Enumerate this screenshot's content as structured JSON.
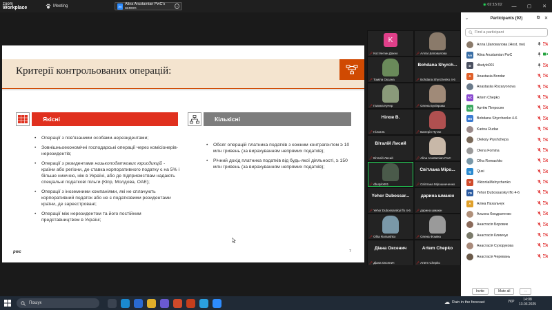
{
  "app": {
    "brand_line1": "zoom",
    "brand_line2": "Workplace",
    "meeting_label": "Meeting",
    "share_initials": "AA",
    "share_label": "Alina Arustamian PwC's screen",
    "timer": "02:15:02",
    "window_controls": [
      "—",
      "▢",
      "✕"
    ]
  },
  "slide": {
    "title": "Критерії контрольованих операцій:",
    "page_number": "7",
    "footer_mark": "pwc",
    "left": {
      "header": "Якісні",
      "header_color": "#e0301e",
      "bullets": [
        {
          "text": "Операції з пов'язаними особами-нерезидентами;"
        },
        {
          "text": "Зовнішньоекономічні господарські операції через комісіонерів-нерезидентів;"
        },
        {
          "pre": "Операції з резидентами ",
          "em": "низькоподаткових юрисдикцій",
          "post": " - країни або регіони, де ставка корпоративного податку є на 5% і більше нижчою, ніж в Україні, або де підприємствам надають спеціальні податкові пільги (Кіпр, Молдова, ОАЕ);"
        },
        {
          "text": "Операції з іноземними компаніями, які не сплачують корпоративний податок або не є податковими резидентами країни, де зареєстровані;"
        },
        {
          "text": "Операції між нерезидентом та його постійним представництвом в Україні;"
        }
      ]
    },
    "right": {
      "header": "Кількісні",
      "header_color": "#7d7d7d",
      "bullets": [
        {
          "text": "Обсяг операцій платника податків з кожним контрагентом ≥ 10 млн гривень (за вирахуванням непрямих податків);"
        },
        {
          "text": "Річний дохід платника податків від будь-якої діяльності, ≥ 150 млн гривень (за вирахуванням непрямих податків);"
        }
      ]
    }
  },
  "video_tiles": [
    {
      "name": "Костянтин Дахно",
      "kind": "avatar",
      "letter": "K",
      "color": "#e0408a"
    },
    {
      "name": "Алла Шаповалова",
      "kind": "photo",
      "color": "#8a7a6a"
    },
    {
      "name": "Томіла Оксана",
      "kind": "photo",
      "color": "#6a8a5a"
    },
    {
      "name": "Bohdana Shyrchenko 4-6",
      "kind": "name",
      "big": "Bohdana Shyrch..."
    },
    {
      "name": "Галина Кучер",
      "kind": "photo",
      "color": "#8a9a7a"
    },
    {
      "name": "Олена Буліярова",
      "kind": "photo",
      "color": "#a08a78"
    },
    {
      "name": "Нілов В.",
      "kind": "name",
      "big": "Нілов В."
    },
    {
      "name": "Валерія Путан",
      "kind": "photo",
      "color": "#b05050"
    },
    {
      "name": "Віталій Лисий",
      "kind": "name",
      "big": "Віталій Лисий"
    },
    {
      "name": "Alina Arustamian PwC",
      "kind": "photo",
      "color": "#c8b8a8"
    },
    {
      "name": "dbutylo001",
      "kind": "photo",
      "color": "#4a5a4a"
    },
    {
      "name": "Світлана Мірошниченко",
      "kind": "name",
      "big": "Світлана Міро..."
    },
    {
      "name": "Yehor Dubossarskyi ffo 4-6",
      "kind": "name",
      "big": "Yehor Dubossar..."
    },
    {
      "name": "дарина шмаюн",
      "kind": "name",
      "big": "дарина шмаюн"
    },
    {
      "name": "Olha Romashko",
      "kind": "photo",
      "color": "#7a98a8"
    },
    {
      "name": "Олена Фоміна",
      "kind": "photo",
      "color": "#9a9a9a"
    },
    {
      "name": "Діана Оксенич",
      "kind": "name",
      "big": "Діана Оксенич"
    },
    {
      "name": "Artem Chepko",
      "kind": "name",
      "big": "Artem Chepko"
    }
  ],
  "participants": {
    "title": "Participants (92)",
    "search_placeholder": "Find a participant",
    "invite_label": "Invite",
    "mute_all_label": "Mute all",
    "more_label": "···",
    "list": [
      {
        "name": "Алла Шаповалова (Host, me)",
        "initials": "",
        "color": "#8a7a6a",
        "mic": "on",
        "video": "off"
      },
      {
        "name": "Alina Arustamian PwC",
        "initials": "AA",
        "color": "#3a6ea5",
        "mic": "on",
        "video": "on"
      },
      {
        "name": "dbutylo001",
        "initials": "D",
        "color": "#4a5060",
        "mic": "on",
        "video": "off"
      },
      {
        "name": "Anastasia Bondar",
        "initials": "A",
        "color": "#e0602a",
        "mic": "off",
        "video": "off"
      },
      {
        "name": "Anastasiia Rozaryonova",
        "initials": "",
        "color": "#6a7a8a",
        "mic": "off",
        "video": "off"
      },
      {
        "name": "Artem Chepko",
        "initials": "AC",
        "color": "#8a4ad0",
        "mic": "off",
        "video": "off"
      },
      {
        "name": "Артём Петросян",
        "initials": "АП",
        "color": "#3aa860",
        "mic": "off",
        "video": "off"
      },
      {
        "name": "Bohdana Shyrchenko 4-6",
        "initials": "BS",
        "color": "#3a7ad0",
        "mic": "off",
        "video": "off"
      },
      {
        "name": "Karina Rudas",
        "initials": "",
        "color": "#9a8a8a",
        "mic": "off",
        "video": "off"
      },
      {
        "name": "Oleksiy Pryshchepa",
        "initials": "",
        "color": "#7a6a5a",
        "mic": "off",
        "video": "off"
      },
      {
        "name": "Olena Fomina",
        "initials": "",
        "color": "#9a9a9a",
        "mic": "off",
        "video": "off"
      },
      {
        "name": "Olha Romashko",
        "initials": "",
        "color": "#7a98a8",
        "mic": "off",
        "video": "off"
      },
      {
        "name": "Qusi",
        "initials": "Q",
        "color": "#2a8ad0",
        "mic": "off",
        "video": "off"
      },
      {
        "name": "ViktoriiaMelnychenko",
        "initials": "V",
        "color": "#d04a2a",
        "mic": "off",
        "video": "off"
      },
      {
        "name": "Yehor Dubossarskyi ffo 4-6",
        "initials": "YD",
        "color": "#2a5aa0",
        "mic": "off",
        "video": "off"
      },
      {
        "name": "Аліна Пахальчук",
        "initials": "А",
        "color": "#e0a02a",
        "mic": "off",
        "video": "off"
      },
      {
        "name": "Альона Кондратенко",
        "initials": "",
        "color": "#b0907a",
        "mic": "off",
        "video": "off"
      },
      {
        "name": "Анастасія Боровик",
        "initials": "",
        "color": "#8a6a5a",
        "mic": "off",
        "video": "off"
      },
      {
        "name": "Анастасія Климчук",
        "initials": "",
        "color": "#7a7a6a",
        "mic": "off",
        "video": "off"
      },
      {
        "name": "Анастасія Сухорукова",
        "initials": "",
        "color": "#a88a7a",
        "mic": "off",
        "video": "off"
      },
      {
        "name": "Анастасія Черевань",
        "initials": "",
        "color": "#6a5a4a",
        "mic": "off",
        "video": "off"
      }
    ]
  },
  "taskbar": {
    "search_placeholder": "Пошук",
    "weather": "Rain in the forecast",
    "language": "УКР",
    "time": "14:08",
    "date": "13.03.2025",
    "apps": [
      {
        "icon": "task-view-icon",
        "color": "#3a4350"
      },
      {
        "icon": "edge-icon",
        "color": "#1a8ad0"
      },
      {
        "icon": "store-icon",
        "color": "#2a6ad0"
      },
      {
        "icon": "explorer-icon",
        "color": "#e0b02a"
      },
      {
        "icon": "teams-icon",
        "color": "#6a5ad0"
      },
      {
        "icon": "chrome-icon",
        "color": "#d04a2a"
      },
      {
        "icon": "powerpoint-icon",
        "color": "#c43e1c"
      },
      {
        "icon": "telegram-icon",
        "color": "#2aa0e0"
      },
      {
        "icon": "zoom-icon",
        "color": "#2d8cff"
      }
    ]
  }
}
